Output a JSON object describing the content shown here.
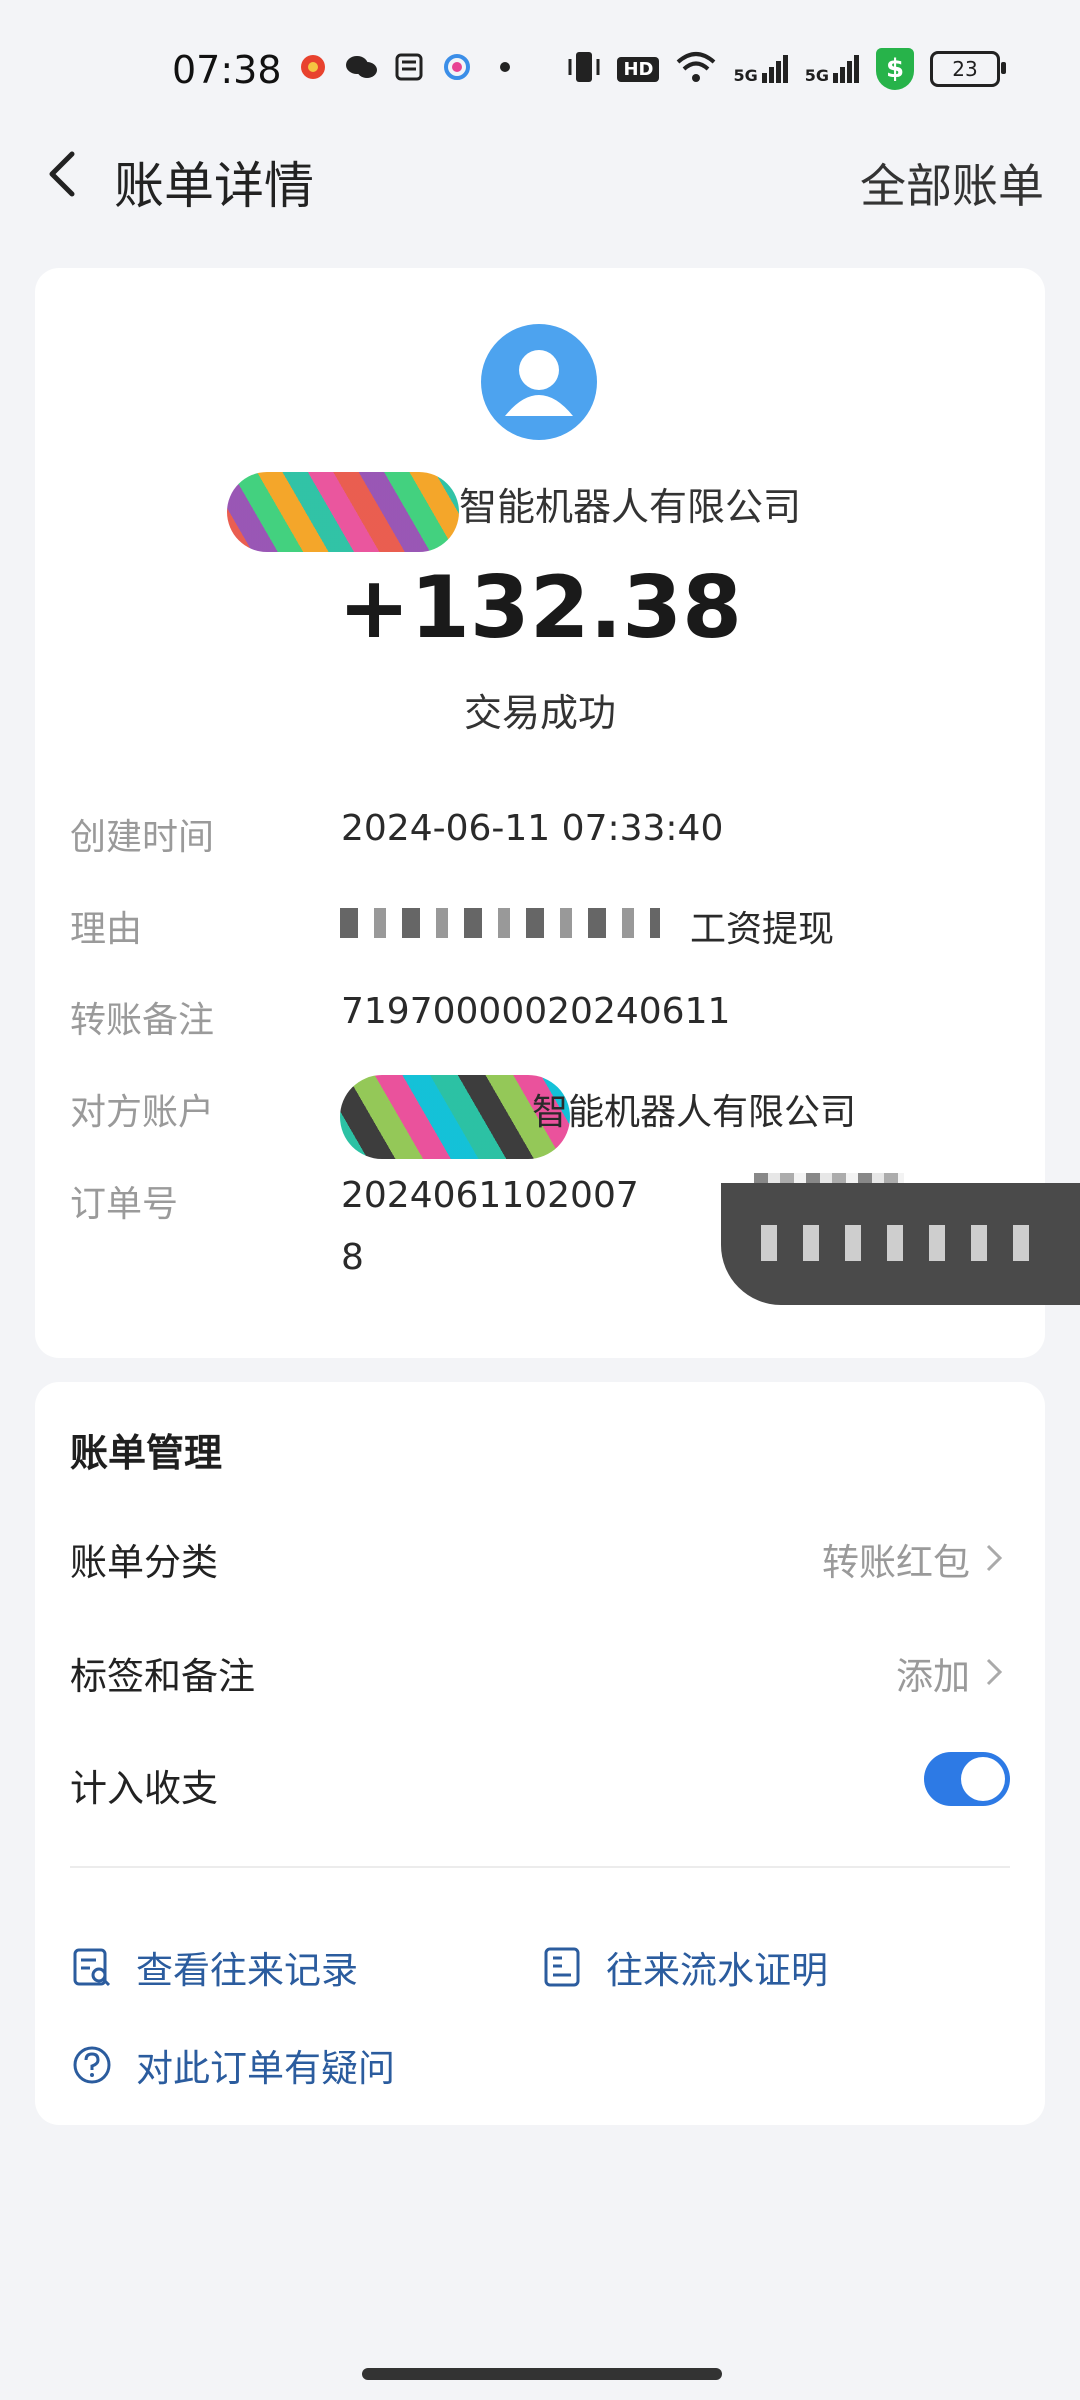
{
  "status_bar": {
    "time": "07:38",
    "hd_label": "HD",
    "signal1_label": "5G",
    "signal2_label": "5G",
    "shield_label": "$",
    "battery_level": "23"
  },
  "header": {
    "title": "账单详情",
    "all_bills": "全部账单"
  },
  "summary": {
    "company_visible": "智能机器人有限公司",
    "amount": "+132.38",
    "status": "交易成功"
  },
  "details": [
    {
      "key": "创建时间",
      "value": "2024-06-11 07:33:40"
    },
    {
      "key": "理由",
      "value": "工资提现"
    },
    {
      "key": "转账备注",
      "value": "71970000020240611"
    },
    {
      "key": "对方账户",
      "value": "智能机器人有限公司"
    },
    {
      "key": "订单号",
      "value": "2024061102007",
      "value_line2": "8"
    }
  ],
  "management": {
    "title": "账单管理",
    "category_label": "账单分类",
    "category_value": "转账红包",
    "tags_label": "标签和备注",
    "tags_value": "添加",
    "include_label": "计入收支",
    "include_on": true,
    "link_records": "查看往来记录",
    "link_proof": "往来流水证明",
    "link_question": "对此订单有疑问"
  },
  "colors": {
    "accent": "#2d7ae5",
    "link": "#2b5c9e",
    "avatar": "#4da3ef",
    "background": "#f3f4f7"
  }
}
